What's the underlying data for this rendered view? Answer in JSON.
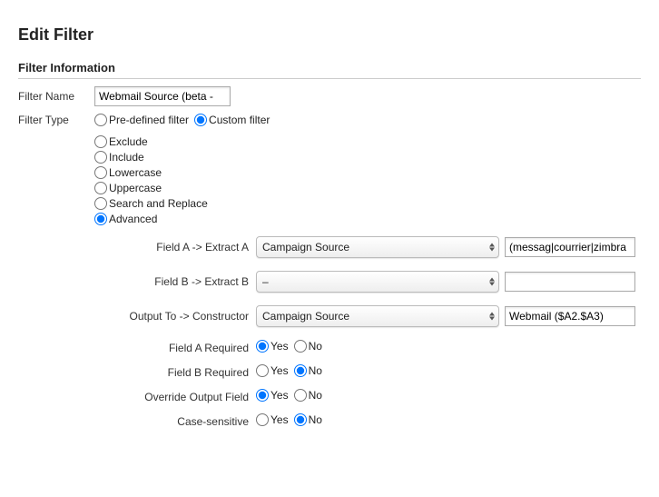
{
  "page_title": "Edit Filter",
  "section_title": "Filter Information",
  "filter_name_label": "Filter Name",
  "filter_name_value": "Webmail Source (beta -",
  "filter_type_label": "Filter Type",
  "filter_type_options": {
    "predefined": "Pre-defined filter",
    "custom": "Custom filter"
  },
  "custom_options": {
    "exclude": "Exclude",
    "include": "Include",
    "lowercase": "Lowercase",
    "uppercase": "Uppercase",
    "search_replace": "Search and Replace",
    "advanced": "Advanced"
  },
  "advanced": {
    "field_a_label": "Field A -> Extract A",
    "field_a_select": "Campaign Source",
    "field_a_value": "(messag|courrier|zimbra",
    "field_b_label": "Field B -> Extract B",
    "field_b_select": "–",
    "field_b_value": "",
    "output_label": "Output To -> Constructor",
    "output_select": "Campaign Source",
    "output_value": "Webmail ($A2.$A3)",
    "field_a_required_label": "Field A Required",
    "field_b_required_label": "Field B Required",
    "override_label": "Override Output Field",
    "case_label": "Case-sensitive",
    "yes": "Yes",
    "no": "No"
  }
}
